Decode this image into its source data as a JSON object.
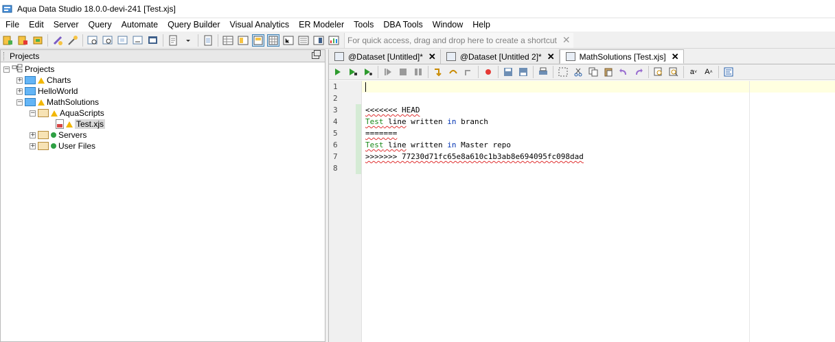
{
  "window": {
    "title": "Aqua Data Studio 18.0.0-devi-241 [Test.xjs]"
  },
  "menu": [
    "File",
    "Edit",
    "Server",
    "Query",
    "Automate",
    "Query Builder",
    "Visual Analytics",
    "ER Modeler",
    "Tools",
    "DBA Tools",
    "Window",
    "Help"
  ],
  "toolbar": {
    "shortcut_hint": "For quick access, drag and drop here to create a shortcut",
    "shortcut_close": "✕"
  },
  "projects_panel": {
    "title": "Projects",
    "tree": {
      "root": "Projects",
      "charts": "Charts",
      "helloworld": "HelloWorld",
      "mathsolutions": "MathSolutions",
      "aquascripts": "AquaScripts",
      "testfile": "Test.xjs",
      "servers": "Servers",
      "userfiles": "User Files"
    }
  },
  "tabs": [
    {
      "label": "@Dataset [Untitled]*",
      "close": "✕"
    },
    {
      "label": "@Dataset [Untitled 2]*",
      "close": "✕"
    },
    {
      "label": "MathSolutions [Test.xjs]",
      "close": "✕"
    }
  ],
  "editor": {
    "line_numbers": [
      "1",
      "2",
      "3",
      "4",
      "5",
      "6",
      "7",
      "8"
    ],
    "lines": {
      "l3": "<<<<<<< HEAD",
      "l4_a": "Test",
      "l4_b": " line",
      "l4_c": " written ",
      "l4_d": "in",
      "l4_e": " branch",
      "l5": "=======",
      "l6_a": "Test",
      "l6_b": " line",
      "l6_c": " written ",
      "l6_d": "in",
      "l6_e": " Master repo",
      "l7": ">>>>>>> 77230d71fc65e8a610c1b3ab8e694095fc098dad"
    }
  },
  "colors": {
    "current_line": "#ffffe0",
    "change_bar": "#d5ebd5",
    "keyword_green": "#1a8a1a",
    "keyword_blue": "#0033b3"
  }
}
